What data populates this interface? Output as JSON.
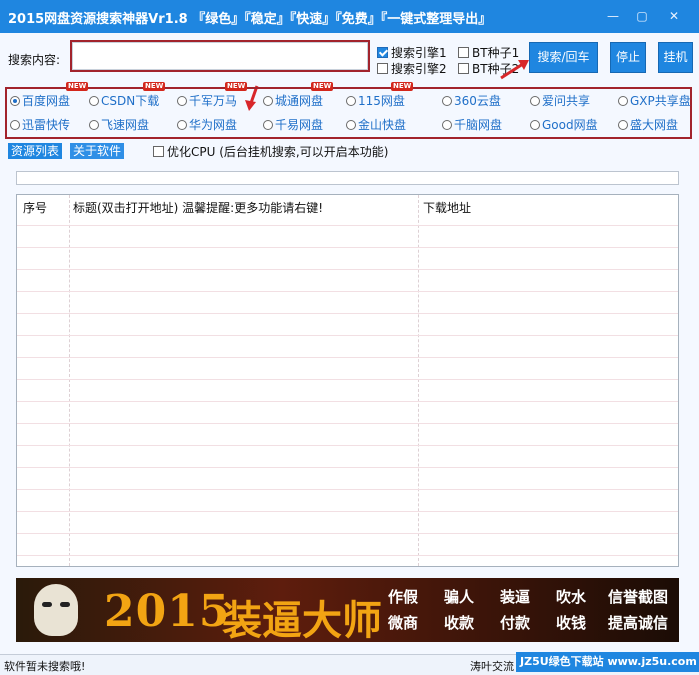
{
  "window": {
    "title": "2015网盘资源搜索神器Vr1.8 『绿色』『稳定』『快速』『免费』『一键式整理导出』",
    "controls": {
      "minimize": "—",
      "maximize": "▢",
      "close": "✕"
    }
  },
  "search": {
    "label": "搜索内容:",
    "value": "",
    "placeholder": ""
  },
  "engines_options": [
    {
      "label": "搜索引擎1",
      "checked": true
    },
    {
      "label": "搜索引擎2",
      "checked": false
    },
    {
      "label": "BT种子1",
      "checked": false
    },
    {
      "label": "BT种子2",
      "checked": false
    }
  ],
  "buttons": {
    "search": "搜索/回车",
    "stop": "停止",
    "hang": "挂机"
  },
  "new_tag": "NEW",
  "sites_row1": [
    {
      "label": "百度网盘",
      "selected": true,
      "new": true
    },
    {
      "label": "CSDN下载",
      "selected": false,
      "new": true
    },
    {
      "label": "千军万马",
      "selected": false,
      "new": true
    },
    {
      "label": "城通网盘",
      "selected": false,
      "new": true
    },
    {
      "label": "115网盘",
      "selected": false,
      "new": true
    },
    {
      "label": "360云盘",
      "selected": false,
      "new": false
    },
    {
      "label": "爱问共享",
      "selected": false,
      "new": false
    },
    {
      "label": "GXP共享盘",
      "selected": false,
      "new": false
    }
  ],
  "sites_row2": [
    {
      "label": "迅雷快传",
      "selected": false
    },
    {
      "label": "飞速网盘",
      "selected": false
    },
    {
      "label": "华为网盘",
      "selected": false
    },
    {
      "label": "千易网盘",
      "selected": false
    },
    {
      "label": "金山快盘",
      "selected": false
    },
    {
      "label": "千脑网盘",
      "selected": false
    },
    {
      "label": "Good网盘",
      "selected": false
    },
    {
      "label": "盛大网盘",
      "selected": false
    }
  ],
  "tabs": {
    "resources": "资源列表",
    "about": "关于软件"
  },
  "optimize_cpu": {
    "label": "优化CPU (后台挂机搜索,可以开启本功能)",
    "checked": false
  },
  "table": {
    "col_index": "序号",
    "col_title": "标题(双击打开地址) 温馨提醒:更多功能请右键!",
    "col_url": "下载地址",
    "rows": []
  },
  "banner": {
    "year": "2015",
    "title": "装逼大师",
    "words": [
      "作假",
      "骗人",
      "装逼",
      "吹水",
      "信誉截图",
      "微商",
      "收款",
      "付款",
      "收钱",
      "提高诚信"
    ]
  },
  "status": {
    "message": "软件暂未搜索哦!",
    "right": "涛叶交流",
    "watermark": "JZ5U绿色下载站 www.jz5u.com"
  },
  "colors": {
    "accent": "#1f86e0",
    "highlight_border": "#a2232c",
    "new_badge": "#d3271c"
  }
}
